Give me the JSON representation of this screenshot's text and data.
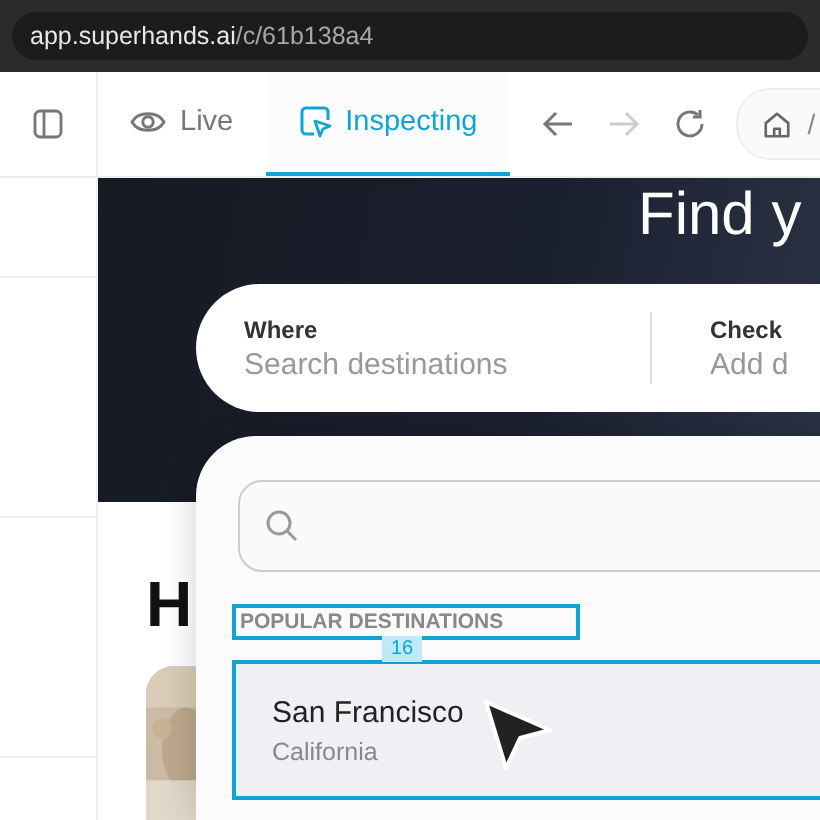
{
  "address_bar": {
    "host": "app.superhands.ai",
    "path": "/c/61b138a4"
  },
  "toolbar": {
    "tabs": [
      {
        "label": "Live",
        "kind": "eye",
        "selected": false
      },
      {
        "label": "Inspecting",
        "kind": "inspect",
        "selected": true
      }
    ],
    "nav": [
      {
        "kind": "back",
        "disabled": false
      },
      {
        "kind": "forward",
        "disabled": true
      },
      {
        "kind": "reload",
        "disabled": false
      }
    ],
    "breadcrumb": "/"
  },
  "hero": {
    "heading": "Find y",
    "search": [
      {
        "label": "Where",
        "placeholder": "Search destinations"
      },
      {
        "label": "Check",
        "placeholder": "Add d"
      }
    ]
  },
  "section_heading": "H",
  "dropdown": {
    "section_label": "POPULAR DESTINATIONS",
    "label_highlighted": true,
    "spacing": "16",
    "items": [
      {
        "name": "San Francisco",
        "region": "California",
        "highlighted": true
      }
    ]
  }
}
